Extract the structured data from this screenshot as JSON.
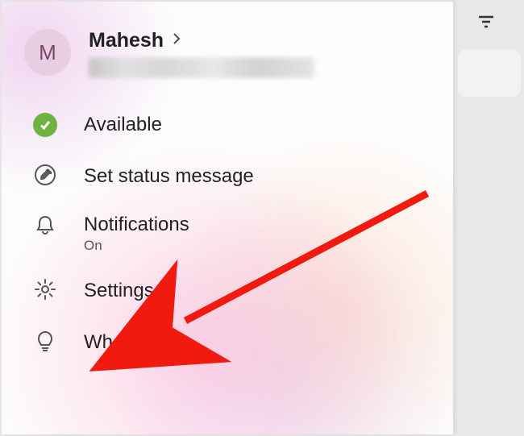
{
  "profile": {
    "initial": "M",
    "name": "Mahesh"
  },
  "menu": {
    "available_label": "Available",
    "set_status_label": "Set status message",
    "notifications_label": "Notifications",
    "notifications_sub": "On",
    "settings_label": "Settings",
    "whats_new_label": "What's new"
  },
  "colors": {
    "available_green": "#6cb33f",
    "annotation_red": "#f01a0e"
  }
}
